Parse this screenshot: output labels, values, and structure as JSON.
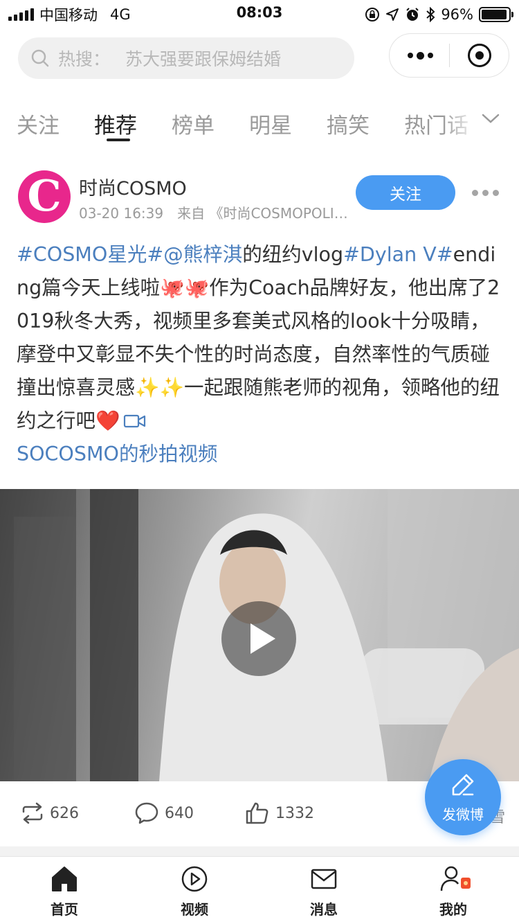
{
  "status_bar": {
    "carrier": "中国移动",
    "network": "4G",
    "time": "08:03",
    "battery": "96%",
    "battery_level": 0.96
  },
  "search": {
    "prefix": "热搜：",
    "keyword": "苏大强要跟保姆结婚"
  },
  "tabs": [
    {
      "label": "关注",
      "active": false
    },
    {
      "label": "推荐",
      "active": true
    },
    {
      "label": "榜单",
      "active": false
    },
    {
      "label": "明星",
      "active": false
    },
    {
      "label": "搞笑",
      "active": false
    },
    {
      "label": "热门话",
      "active": false
    }
  ],
  "post": {
    "author": "时尚COSMO",
    "avatar_letter": "C",
    "time": "03-20 16:39",
    "source": "来自 《时尚COSMOPOLITAN》",
    "follow_label": "关注",
    "body": {
      "tag1": "#COSMO星光#",
      "mention": "@熊梓淇",
      "seg1": "的纽约vlog",
      "tag2": "#Dylan V#",
      "seg2": "ending篇今天上线啦",
      "emoji_sticker": "🐙🐙",
      "seg3": "作为Coach品牌好友，他出席了2019秋冬大秀，视频里多套美式风格的look十分吸睛，摩登中又彰显不失个性的时尚态度，自然率性的气质碰撞出惊喜灵感",
      "sparkles": "✨✨",
      "seg4": "一起跟随熊老师的视角，领略他的纽约之行吧",
      "heart": "❤️",
      "video_link": "SOCOSMO的秒拍视频"
    },
    "reposts": "626",
    "comments": "640",
    "likes": "1332"
  },
  "compose": {
    "label": "发微博"
  },
  "peek": "雪",
  "bottom_nav": [
    {
      "label": "首页",
      "icon": "home-icon"
    },
    {
      "label": "视频",
      "icon": "video-play-icon"
    },
    {
      "label": "消息",
      "icon": "mail-icon"
    },
    {
      "label": "我的",
      "icon": "profile-icon"
    }
  ],
  "colors": {
    "accent": "#4a9bf2",
    "link": "#4b7fbe",
    "avatar": "#e8278c"
  }
}
